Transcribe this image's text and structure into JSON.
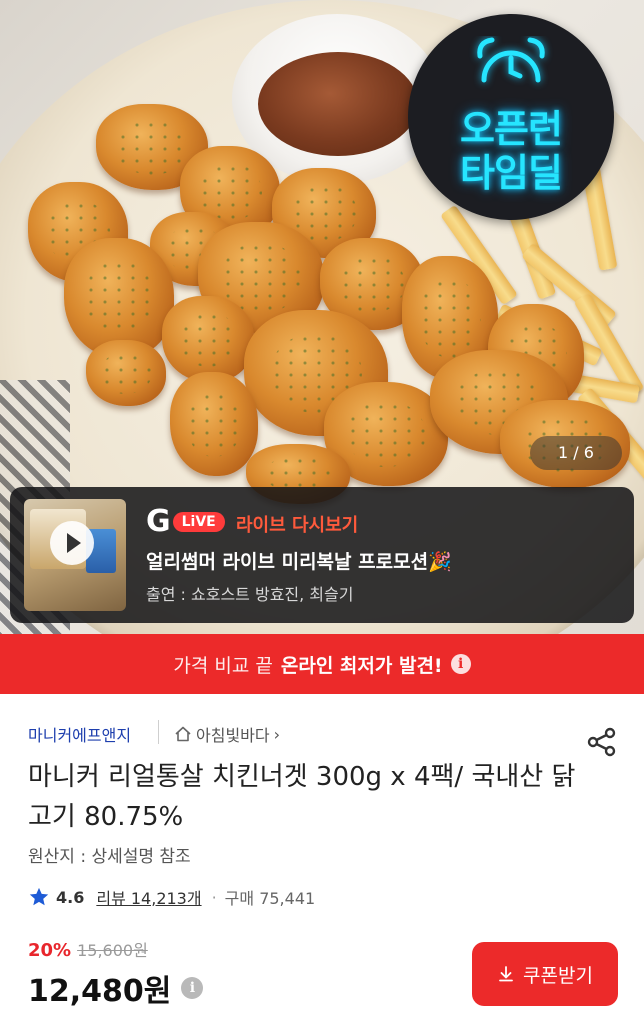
{
  "hero": {
    "badge_line1": "오픈런",
    "badge_line2": "타임딜",
    "image_counter": "1 / 6"
  },
  "live_card": {
    "brand_letter": "G",
    "brand_badge": "LiVE",
    "tag": "라이브 다시보기",
    "title": "얼리썸머 라이브 미리복날 프로모션🎉",
    "cast": "출연 : 쇼호스트 방효진, 최슬기"
  },
  "promo_banner": {
    "prefix": "가격 비교 끝",
    "highlight": "온라인 최저가 발견!",
    "info_icon": "i"
  },
  "product": {
    "seller": "마니커에프앤지",
    "store": "아침빛바다",
    "store_chevron": "›",
    "title": "마니커 리얼통살 치킨너겟 300g x 4팩/ 국내산 닭고기 80.75%",
    "origin": "원산지 : 상세설명 참조",
    "rating": "4.6",
    "reviews": "리뷰 14,213개",
    "dot": "·",
    "purchases": "구매 75,441",
    "discount_percent": "20%",
    "original_price": "15,600원",
    "price": "12,480원",
    "price_info_icon": "i",
    "coupon_button": "쿠폰받기"
  },
  "colors": {
    "accent_red": "#ec2a2a",
    "seller_blue": "#1e3fae",
    "neon_cyan": "#26e5ff",
    "star_blue": "#1e5bd6"
  },
  "icons": [
    "alarm-clock-icon",
    "play-icon",
    "home-icon",
    "chevron-right-icon",
    "share-icon",
    "star-icon",
    "info-icon",
    "download-icon"
  ]
}
